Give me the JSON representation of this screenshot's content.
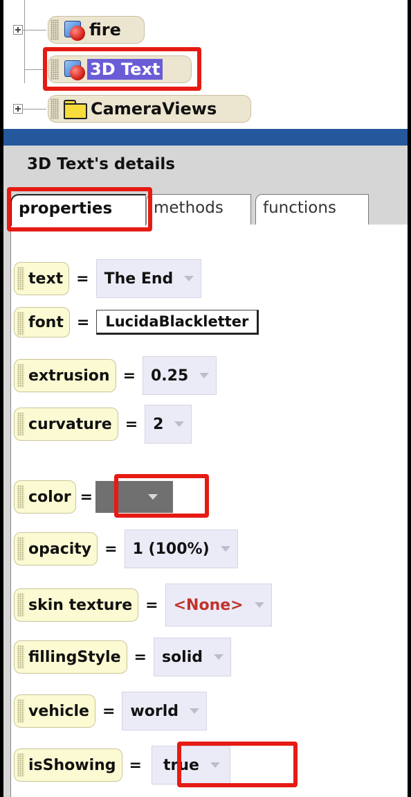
{
  "tree": {
    "items": [
      {
        "label": "fire",
        "icon": "object-icon",
        "expandable": true
      },
      {
        "label": "3D Text",
        "icon": "object-icon",
        "expandable": false,
        "selected": true
      },
      {
        "label": "CameraViews",
        "icon": "folder-icon",
        "expandable": true
      }
    ]
  },
  "details": {
    "title": "3D Text's details",
    "tabs": [
      {
        "label": "properties",
        "active": true
      },
      {
        "label": "methods",
        "active": false
      },
      {
        "label": "functions",
        "active": false
      }
    ]
  },
  "properties": {
    "equals": "=",
    "rows": [
      {
        "name": "text",
        "value": "The End"
      },
      {
        "name": "font",
        "value": "LucidaBlackletter"
      },
      {
        "name": "extrusion",
        "value": "0.25"
      },
      {
        "name": "curvature",
        "value": "2"
      },
      {
        "name": "color",
        "value_color": "#707070"
      },
      {
        "name": "opacity",
        "value": "1 (100%)"
      },
      {
        "name": "skin texture",
        "value": "<None>"
      },
      {
        "name": "fillingStyle",
        "value": "solid"
      },
      {
        "name": "vehicle",
        "value": "world"
      },
      {
        "name": "isShowing",
        "value": "true"
      }
    ]
  },
  "colors": {
    "highlight": "#e51b14",
    "selection": "#6a5cd6",
    "divider_bar": "#24579b",
    "tile": "#fbfad2",
    "none_value": "#c0332b"
  }
}
